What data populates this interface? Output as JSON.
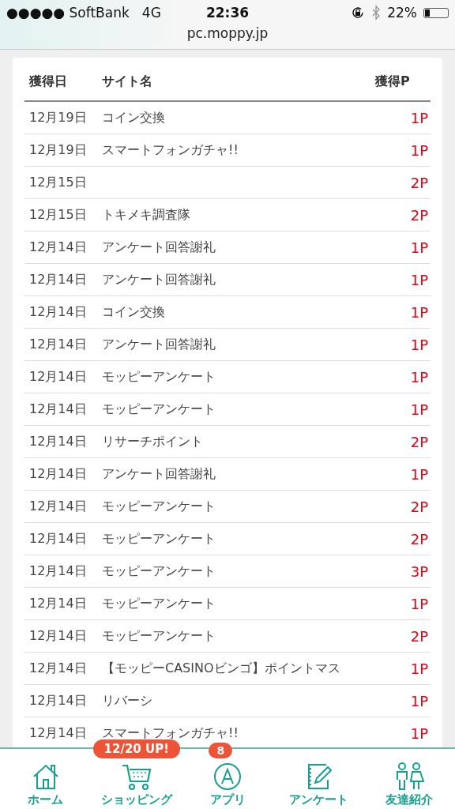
{
  "status_bar": {
    "carrier": "●●●●● SoftBank",
    "network": "4G",
    "time": "22:36",
    "battery": "22%"
  },
  "address_bar": {
    "url": "pc.moppy.jp"
  },
  "table": {
    "columns": [
      "獲得日",
      "サイト名",
      "獲得P"
    ],
    "rows": [
      {
        "date": "12月19日",
        "site": "コイン交換",
        "points": "1P"
      },
      {
        "date": "12月19日",
        "site": "スマートフォンガチャ!!",
        "points": "1P"
      },
      {
        "date": "12月15日",
        "points": "2P"
      },
      {
        "date": "12月15日",
        "site": "トキメキ調査隊",
        "points": "2P"
      },
      {
        "date": "12月14日",
        "site": "アンケート回答謝礼",
        "points": "1P"
      },
      {
        "date": "12月14日",
        "site": "アンケート回答謝礼",
        "points": "1P"
      },
      {
        "date": "12月14日",
        "site": "コイン交換",
        "points": "1P"
      },
      {
        "date": "12月14日",
        "site": "アンケート回答謝礼",
        "points": "1P"
      },
      {
        "date": "12月14日",
        "site": "モッピーアンケート",
        "points": "1P"
      },
      {
        "date": "12月14日",
        "site": "モッピーアンケート",
        "points": "1P"
      },
      {
        "date": "12月14日",
        "site": "リサーチポイント",
        "points": "2P"
      },
      {
        "date": "12月14日",
        "site": "アンケート回答謝礼",
        "points": "1P"
      },
      {
        "date": "12月14日",
        "site": "モッピーアンケート",
        "points": "2P"
      },
      {
        "date": "12月14日",
        "site": "モッピーアンケート",
        "points": "2P"
      },
      {
        "date": "12月14日",
        "site": "モッピーアンケート",
        "points": "3P"
      },
      {
        "date": "12月14日",
        "site": "モッピーアンケート",
        "points": "1P"
      },
      {
        "date": "12月14日",
        "site": "モッピーアンケート",
        "points": "2P"
      },
      {
        "date": "12月14日",
        "site": "【モッピーCASINOビンゴ】ポイントマス",
        "points": "1P"
      },
      {
        "date": "12月14日",
        "site": "リバーシ",
        "points": "1P"
      },
      {
        "date": "12月14日",
        "site": "スマートフォンガチャ!!",
        "points": "1P"
      }
    ]
  },
  "bottom_nav": [
    {
      "kind": "home",
      "label": "ホーム"
    },
    {
      "kind": "shopping",
      "label": "ショッピング",
      "badge": "12/20 UP!"
    },
    {
      "kind": "app",
      "label": "アプリ",
      "badge": "8"
    },
    {
      "kind": "survey",
      "label": "アンケート"
    },
    {
      "kind": "friends",
      "label": "友達紹介"
    }
  ]
}
